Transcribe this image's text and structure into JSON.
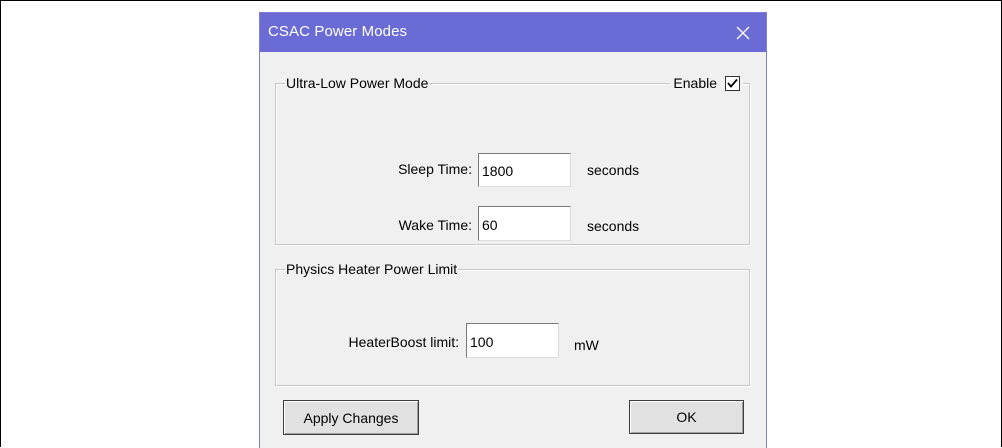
{
  "window": {
    "title": "CSAC Power Modes",
    "close_glyph": "✕"
  },
  "ultra_low_power": {
    "legend": "Ultra-Low Power Mode",
    "enable_label": "Enable",
    "enable_checked": true,
    "sleep_time_label": "Sleep Time:",
    "sleep_time_value": "1800",
    "sleep_time_unit": "seconds",
    "wake_time_label": "Wake Time:",
    "wake_time_value": "60",
    "wake_time_unit": "seconds"
  },
  "heater": {
    "legend": "Physics Heater Power Limit",
    "boost_label": "HeaterBoost limit:",
    "boost_value": "100",
    "boost_unit": "mW"
  },
  "buttons": {
    "apply_label": "Apply Changes",
    "ok_label": "OK"
  },
  "colors": {
    "titlebar": "#6b6bd6",
    "dialog_bg": "#f0f0f0",
    "page_bg": "#ffffff"
  },
  "icons": {
    "close": "close-icon",
    "check": "checkmark-icon"
  }
}
